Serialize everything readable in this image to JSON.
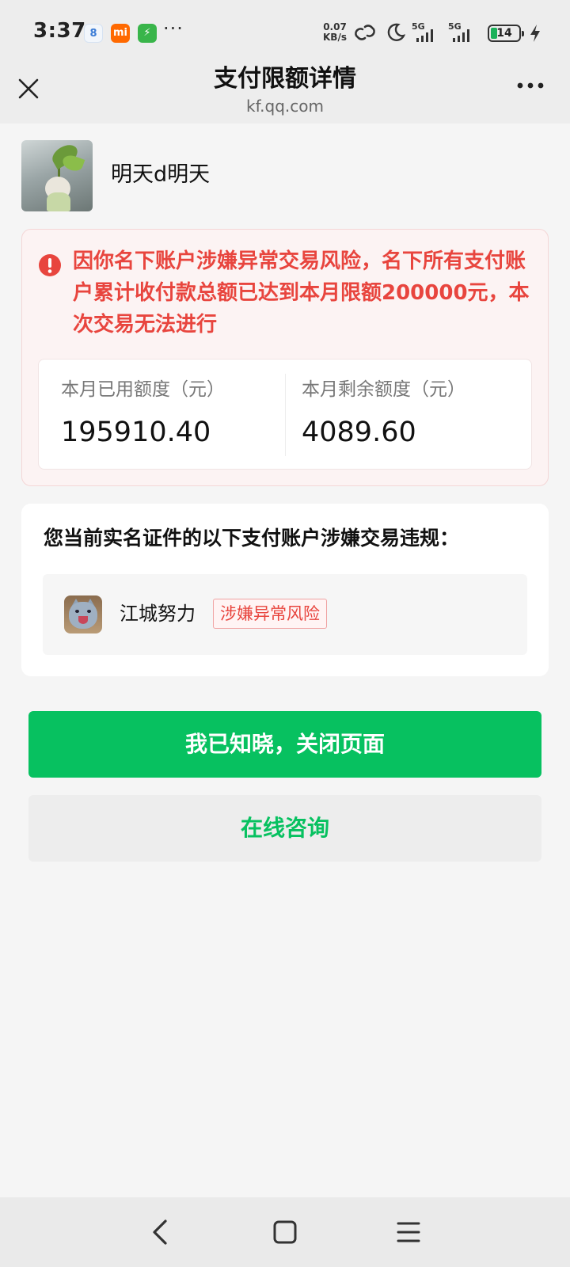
{
  "status_bar": {
    "time": "3:37",
    "app_icons": [
      {
        "name": "calendar-app-icon",
        "text": "8",
        "color": "#3a7bd5"
      },
      {
        "name": "mi-app-icon",
        "text": "mi",
        "color": "#ff6900"
      },
      {
        "name": "bolt-app-icon",
        "text": "⚡",
        "color": "#39b54a"
      }
    ],
    "more": "···",
    "net_speed_value": "0.07",
    "net_speed_unit": "KB/s",
    "signal1": "5G",
    "signal2": "5G",
    "battery": "14"
  },
  "header": {
    "title": "支付限额详情",
    "subtitle": "kf.qq.com"
  },
  "profile": {
    "name": "明天d明天"
  },
  "alert": {
    "message": "因你名下账户涉嫌异常交易风险，名下所有支付账户累计收付款总额已达到本月限额200000元，本次交易无法进行",
    "color": "#e8453e"
  },
  "quota": {
    "used_label": "本月已用额度（元）",
    "used_value": "195910.40",
    "remaining_label": "本月剩余额度（元）",
    "remaining_value": "4089.60"
  },
  "accounts": {
    "title": "您当前实名证件的以下支付账户涉嫌交易违规：",
    "items": [
      {
        "name": "江城努力",
        "tag": "涉嫌异常风险"
      }
    ]
  },
  "buttons": {
    "confirm_label": "我已知晓，关闭页面",
    "consult_label": "在线咨询",
    "accent": "#07c160"
  }
}
